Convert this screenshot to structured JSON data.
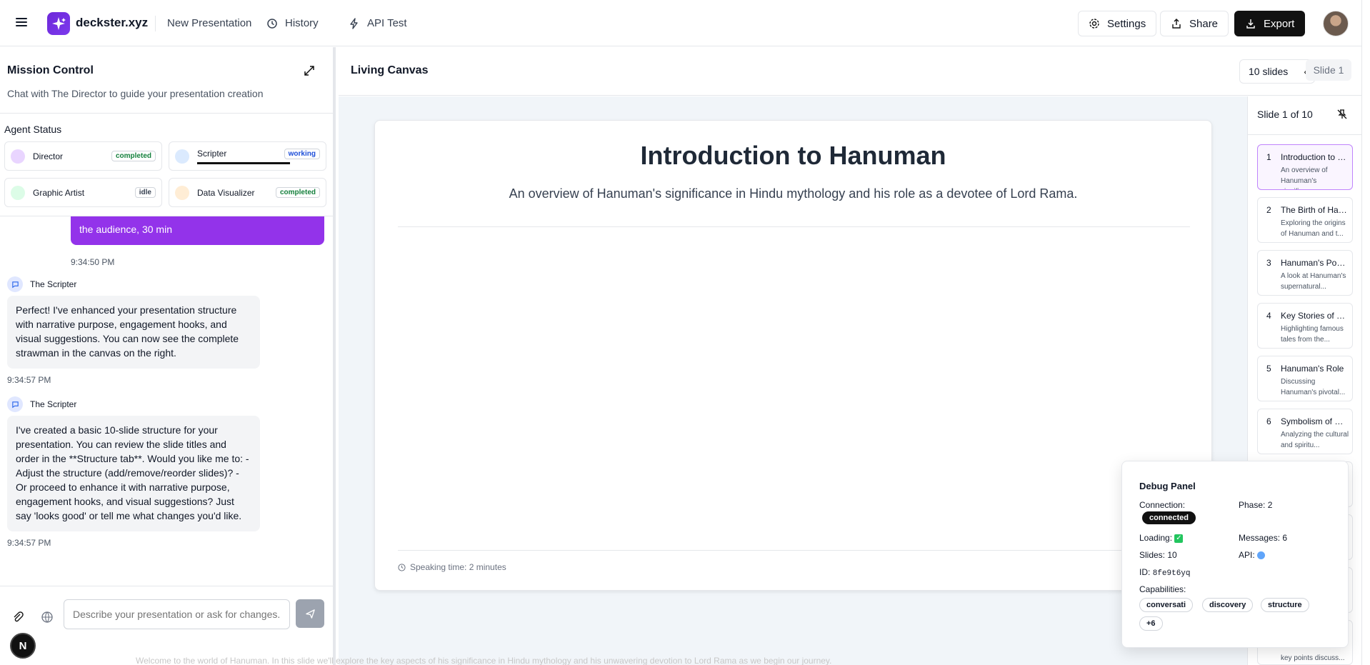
{
  "header": {
    "brand": "deckster.xyz",
    "nav": [
      "New Presentation",
      "History",
      "API Test"
    ],
    "settings_label": "Settings",
    "share_label": "Share",
    "export_label": "Export"
  },
  "mission_control": {
    "title": "Mission Control",
    "subtitle": "Chat with The Director to guide your presentation creation",
    "agent_status_label": "Agent Status",
    "agents": [
      {
        "name": "Director",
        "status": "completed",
        "color": "#e9d5ff"
      },
      {
        "name": "Scripter",
        "status": "working",
        "color": "#dbeafe"
      },
      {
        "name": "Graphic Artist",
        "status": "idle",
        "color": "#dcfce7"
      },
      {
        "name": "Data Visualizer",
        "status": "completed",
        "color": "#ffedd5"
      }
    ]
  },
  "chat": {
    "user_message_tail": "the audience, 30 min",
    "user_time": "9:34:50 PM",
    "messages": [
      {
        "sender": "The Scripter",
        "text": "Perfect! I've enhanced your presentation structure with narrative purpose, engagement hooks, and visual suggestions. You can now see the complete strawman in the canvas on the right.",
        "time": "9:34:57 PM"
      },
      {
        "sender": "The Scripter",
        "text": "I've created a basic 10-slide structure for your presentation. You can review the slide titles and order in the **Structure tab**. Would you like me to: - Adjust the structure (add/remove/reorder slides)? - Or proceed to enhance it with narrative purpose, engagement hooks, and visual suggestions? Just say 'looks good' or tell me what changes you'd like.",
        "time": "9:34:57 PM"
      }
    ],
    "input_placeholder": "Describe your presentation or ask for changes...",
    "user_initial": "N"
  },
  "canvas": {
    "title": "Living Canvas",
    "slides_count": "10 slides",
    "slide_tab": "Slide 1",
    "slide": {
      "title": "Introduction to Hanuman",
      "subtitle": "An overview of Hanuman's significance in Hindu mythology and his role as a devotee of Lord Rama.",
      "speaking_time": "Speaking time: 2 minutes"
    },
    "bottom_ghost": "Welcome to the world of Hanuman. In this slide we'll explore the key aspects of his significance in Hindu mythology and his unwavering devotion to Lord Rama as we begin our journey."
  },
  "slide_list": {
    "header": "Slide 1 of 10",
    "items": [
      {
        "num": "1",
        "title": "Introduction to Hanuman",
        "desc": "An overview of Hanuman's significance..."
      },
      {
        "num": "2",
        "title": "The Birth of Hanuman",
        "desc": "Exploring the origins of Hanuman and t..."
      },
      {
        "num": "3",
        "title": "Hanuman's Powers",
        "desc": "A look at Hanuman's supernatural..."
      },
      {
        "num": "4",
        "title": "Key Stories of Hanuman",
        "desc": "Highlighting famous tales from the..."
      },
      {
        "num": "5",
        "title": "Hanuman's Role",
        "desc": "Discussing Hanuman's pivotal..."
      },
      {
        "num": "6",
        "title": "Symbolism of Hanuman",
        "desc": "Analyzing the cultural and spiritu..."
      }
    ],
    "tail_text": "key points discuss..."
  },
  "debug": {
    "title": "Debug Panel",
    "connection_label": "Connection:",
    "connection_value": "connected",
    "phase": "Phase: 2",
    "loading": "Loading:",
    "messages": "Messages: 6",
    "slides": "Slides: 10",
    "api": "API:",
    "id_label": "ID:",
    "id_value": "8fe9t6yq",
    "capabilities_label": "Capabilities:",
    "capabilities": [
      "conversati",
      "discovery",
      "structure",
      "+6"
    ]
  }
}
